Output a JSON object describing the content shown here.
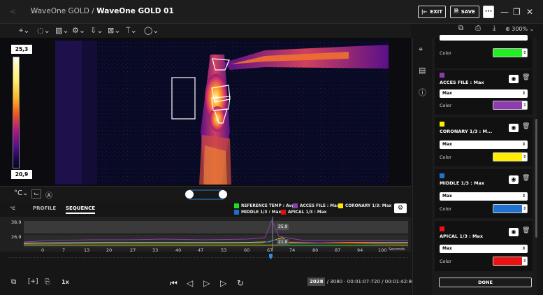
{
  "window": {
    "nav_arrows": "<  >",
    "title_prefix": "WaveOne GOLD / ",
    "title_bold": "WaveOne GOLD 01",
    "exit_label": "EXIT",
    "save_label": "SAVE",
    "more_label": "···",
    "minimize": "—",
    "restore": "❐",
    "close": "✕"
  },
  "toolbar": {
    "tools": [
      "⌖⌄",
      "◌⌄",
      "▨⌄",
      "⚙⌄",
      "⇩⌄",
      "⊠⌄",
      "⍑⌄",
      "◯⌄"
    ],
    "right_tools": [
      "⧉",
      "⎙",
      "⤓"
    ],
    "zoom": "300%"
  },
  "scale": {
    "max": "25,3",
    "min": "20,9"
  },
  "graph": {
    "unit": "°C",
    "tab_profile": "PROFILE",
    "tab_sequence": "SEQUENCE",
    "y_high": "38,9",
    "y_low": "26,9",
    "value_top": "35,9",
    "value_bottom": "21,9",
    "x_ticks": [
      "0",
      "7",
      "13",
      "20",
      "27",
      "33",
      "40",
      "47",
      "53",
      "60",
      "67",
      "74",
      "80",
      "87",
      "94",
      "100"
    ],
    "x_unit": "Seconds",
    "legend": [
      {
        "label": "REFERENCE TEMP : Avg",
        "color": "#22dd22"
      },
      {
        "label": "ACCES FILE : Max",
        "color": "#8e3bb0"
      },
      {
        "label": "CORONARY 1/3: Max",
        "color": "#ffe600"
      },
      {
        "label": "MIDDLE 1/3 : Max",
        "color": "#1f6fd0"
      },
      {
        "label": "APICAL 1/3 : Max",
        "color": "#e01010"
      }
    ]
  },
  "player": {
    "speed": "1x",
    "frame_current": "2028",
    "frame_total": "/ 3080",
    "time": "· 00:01:07:720 / 00:01:42:867"
  },
  "panel": {
    "color_label": "Color",
    "cards": [
      {
        "name": "",
        "mode": "",
        "color": "#22ee22"
      },
      {
        "name": "ACCES FILE : Max",
        "mode": "Max",
        "color": "#8e3bb0"
      },
      {
        "name": "CORONARY 1/3 : M...",
        "mode": "Max",
        "color": "#ffee00"
      },
      {
        "name": "MIDDLE 1/3 : Max",
        "mode": "Max",
        "color": "#1f72d0"
      },
      {
        "name": "APICAL 1/3 : Max",
        "mode": "Max",
        "color": "#ee1111"
      }
    ],
    "done_label": "DONE"
  }
}
